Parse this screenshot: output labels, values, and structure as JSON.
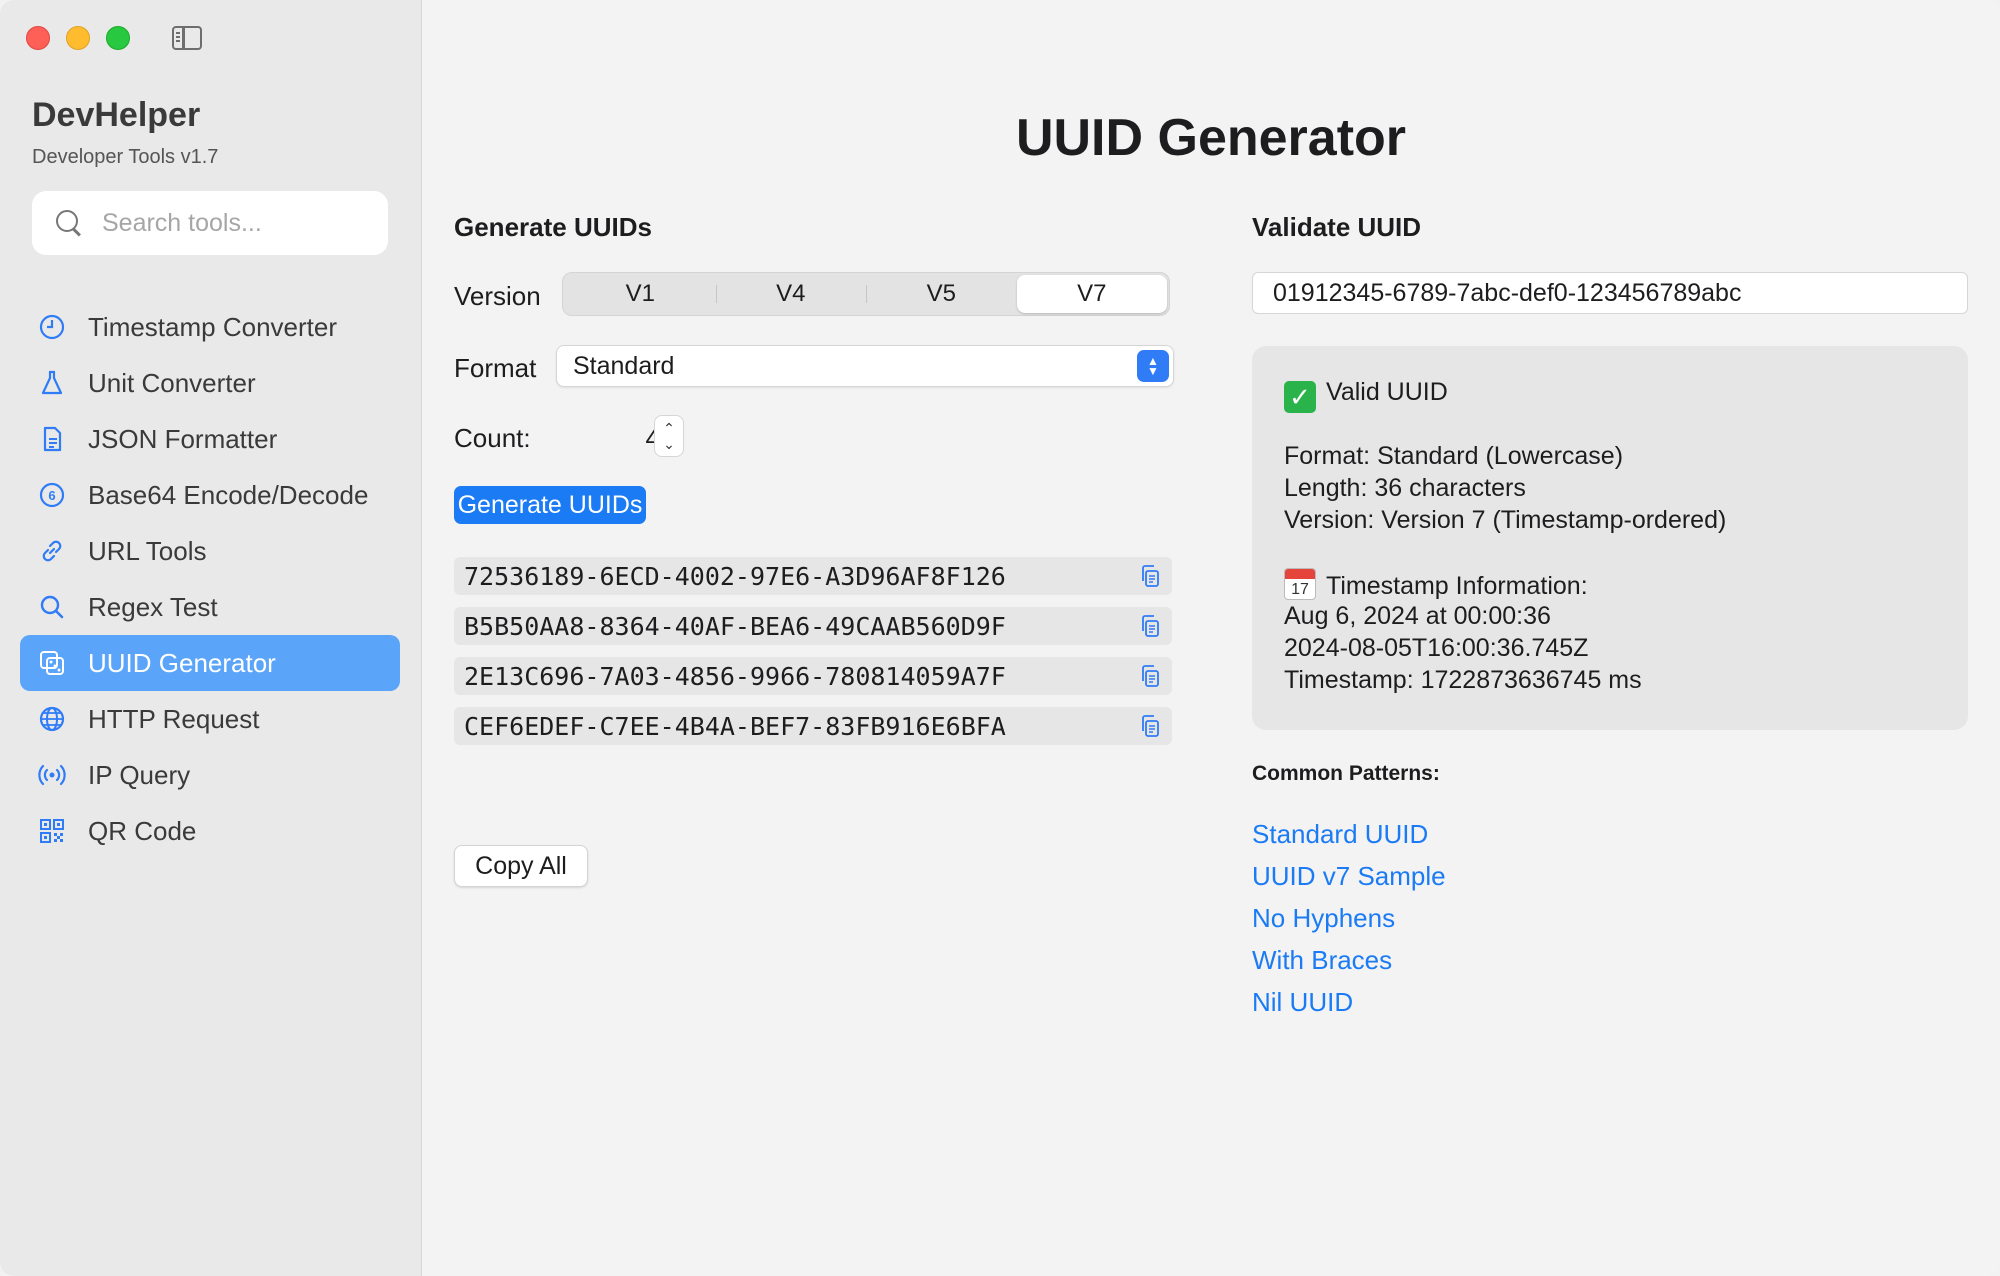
{
  "app": {
    "name": "DevHelper",
    "subtitle": "Developer Tools v1.7"
  },
  "search": {
    "placeholder": "Search tools..."
  },
  "sidebar": {
    "items": [
      {
        "label": "Timestamp Converter",
        "icon": "clock-icon",
        "active": false
      },
      {
        "label": "Unit Converter",
        "icon": "flask-icon",
        "active": false
      },
      {
        "label": "JSON Formatter",
        "icon": "document-icon",
        "active": false
      },
      {
        "label": "Base64 Encode/Decode",
        "icon": "six-circle-icon",
        "active": false
      },
      {
        "label": "URL Tools",
        "icon": "link-icon",
        "active": false
      },
      {
        "label": "Regex Test",
        "icon": "magnifier-icon",
        "active": false
      },
      {
        "label": "UUID Generator",
        "icon": "dice-icon",
        "active": true
      },
      {
        "label": "HTTP Request",
        "icon": "globe-icon",
        "active": false
      },
      {
        "label": "IP Query",
        "icon": "broadcast-icon",
        "active": false
      },
      {
        "label": "QR Code",
        "icon": "qrcode-icon",
        "active": false
      }
    ]
  },
  "page": {
    "title": "UUID Generator"
  },
  "generate": {
    "heading": "Generate UUIDs",
    "version_label": "Version",
    "versions": [
      "V1",
      "V4",
      "V5",
      "V7"
    ],
    "selected_version": "V7",
    "format_label": "Format",
    "format_value": "Standard",
    "count_label": "Count:",
    "count_value": "4",
    "button_label": "Generate UUIDs",
    "uuids": [
      "72536189-6ECD-4002-97E6-A3D96AF8F126",
      "B5B50AA8-8364-40AF-BEA6-49CAAB560D9F",
      "2E13C696-7A03-4856-9966-780814059A7F",
      "CEF6EDEF-C7EE-4B4A-BEF7-83FB916E6BFA"
    ],
    "copy_all_label": "Copy All"
  },
  "validate": {
    "heading": "Validate UUID",
    "input_value": "01912345-6789-7abc-def0-123456789abc",
    "status": "Valid UUID",
    "format": "Format: Standard (Lowercase)",
    "length": "Length: 36 characters",
    "version": "Version: Version 7 (Timestamp-ordered)",
    "timestamp_heading": "Timestamp Information:",
    "calendar_day": "17",
    "date_human": "Aug 6, 2024 at 00:00:36",
    "date_iso": "2024-08-05T16:00:36.745Z",
    "timestamp_ms": "Timestamp: 1722873636745 ms"
  },
  "patterns": {
    "heading": "Common Patterns:",
    "links": [
      "Standard UUID",
      "UUID v7 Sample",
      "No Hyphens",
      "With Braces",
      "Nil UUID"
    ]
  },
  "colors": {
    "accent": "#1a7bf5",
    "sidebar_active": "#5aa4f9",
    "valid": "#29b34a"
  }
}
